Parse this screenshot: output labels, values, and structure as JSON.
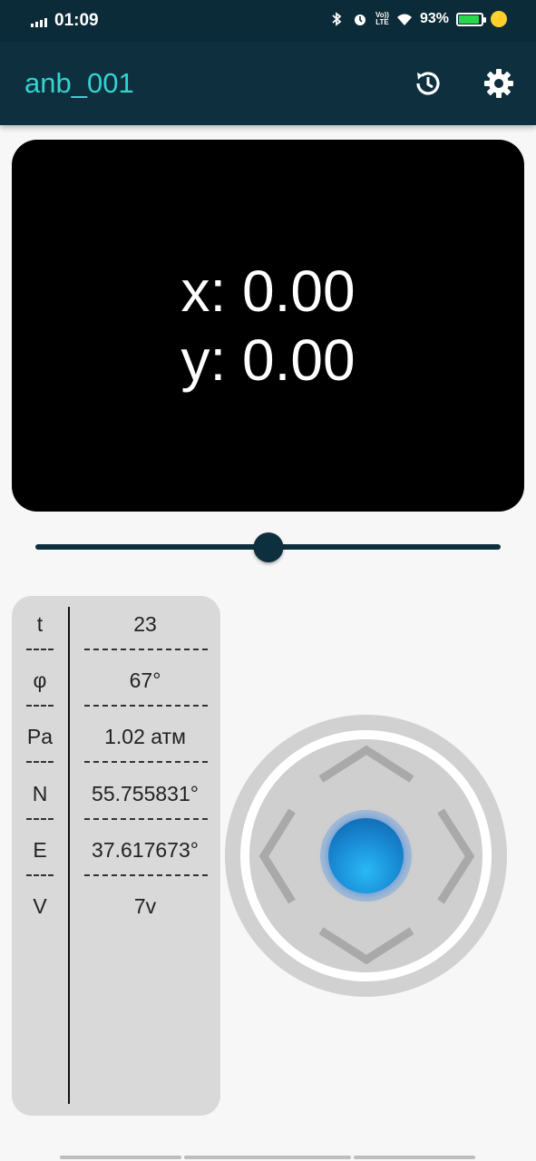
{
  "status_bar": {
    "time": "01:09",
    "volte": [
      "Vo))",
      "LTE"
    ],
    "battery_percent": "93%",
    "battery_level": 0.93,
    "battery_color": "#27d84a",
    "icons": [
      "signal-icon",
      "bluetooth-icon",
      "alarm-icon",
      "volte-icon",
      "wifi-icon",
      "battery-icon",
      "charging-icon"
    ]
  },
  "app_bar": {
    "title": "anb_001",
    "title_color": "#35d2cf",
    "background": "#0d2f3e",
    "actions": [
      "history-icon",
      "settings-icon"
    ]
  },
  "display": {
    "x_text": "x: 0.00",
    "y_text": "y: 0.00"
  },
  "slider": {
    "value_fraction": 0.5,
    "color": "#0d2f3e"
  },
  "telemetry": {
    "rows": [
      {
        "key": "t",
        "value": "23"
      },
      {
        "key": "φ",
        "value": "67°"
      },
      {
        "key": "Pa",
        "value": "1.02 атм"
      },
      {
        "key": "N",
        "value": "55.755831°"
      },
      {
        "key": "E",
        "value": "37.617673°"
      },
      {
        "key": "V",
        "value": "7v"
      }
    ]
  },
  "joystick": {
    "knob_color": "#1a8fd8",
    "arrows": [
      "up-arrow-icon",
      "down-arrow-icon",
      "left-arrow-icon",
      "right-arrow-icon"
    ]
  }
}
